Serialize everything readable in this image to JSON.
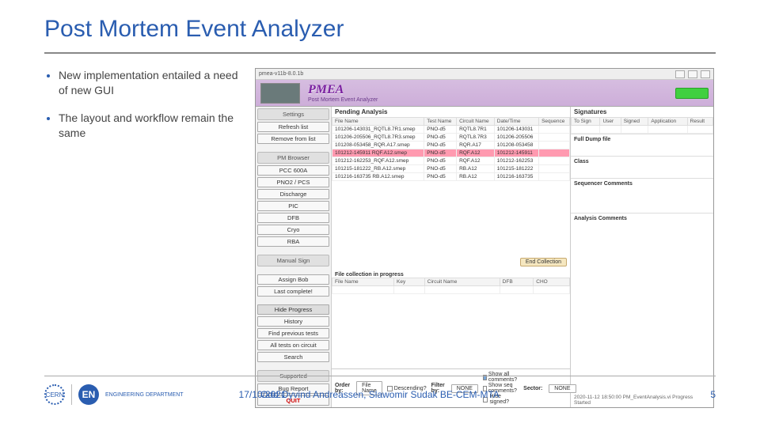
{
  "title": "Post Mortem Event Analyzer",
  "bullets": [
    "New implementation entailed a need of new GUI",
    "The layout and workflow remain the same"
  ],
  "app": {
    "windowTitle": "pmea-v11b-8.0.1b",
    "banner": {
      "logo": "PMEA",
      "sub": "Post Mortem Event Analyzer"
    },
    "side": {
      "settings": "Settings",
      "refresh": "Refresh list",
      "remove": "Remove from list",
      "pmBrowser": "PM Browser",
      "items": [
        "PCC 600A",
        "PNO2 / PCS",
        "Discharge",
        "PIC",
        "DFB",
        "Cryo",
        "RBA"
      ],
      "manualSign": "Manual Sign",
      "assign": "Assign Bob",
      "lastComplete": "Last complete!",
      "hideProgress": "Hide Progress",
      "history": "History",
      "findPrev": "Find previous tests",
      "allTests": "All tests on circuit",
      "search": "Search",
      "supported": "Supported",
      "bug": "Bug Report",
      "quit": "QUIT"
    },
    "pending": {
      "title": "Pending Analysis",
      "cols": [
        "File Name",
        "Test Name",
        "Circuit Name",
        "Date/Time",
        "Sequence"
      ],
      "rows": [
        [
          "101206-143031_RQTL8.7R1.smep",
          "PNO-d5",
          "RQTL8.7R1",
          "101206-143031",
          ""
        ],
        [
          "101206-205506_RQTL8.7R3.smep",
          "PNO-d5",
          "RQTL8.7R3",
          "101206-205506",
          ""
        ],
        [
          "101208-053458_RQR.A17.smep",
          "PNO-d5",
          "RQR.A17",
          "101208-053458",
          ""
        ],
        [
          "101212-145911 RQF.A12.smep",
          "PNO-d5",
          "RQF.A12",
          "101212-145911",
          ""
        ],
        [
          "101212-162253_RQF.A12.smep",
          "PNO-d5",
          "RQF.A12",
          "101212-162253",
          ""
        ],
        [
          "101215-181222_RB.A12.smep",
          "PNO-d5",
          "RB.A12",
          "101215-181222",
          ""
        ],
        [
          "101216-163735 RB.A12.smep",
          "PNO-d5",
          "RB.A12",
          "101216-163735",
          ""
        ]
      ],
      "highlightRow": 3,
      "sub": "File collection in progress",
      "cols2": [
        "File Name",
        "Key",
        "Circuit Name",
        "DFB",
        "CHO"
      ],
      "endCollection": "End Collection",
      "order": {
        "orderBy": "Order by:",
        "orderVal": "File Name",
        "desc": "Descending?",
        "filterBy": "Filter by:",
        "filterVal": "NONE",
        "checks": [
          "Show all comments?",
          "Show seq comments?",
          "Hide signed?"
        ],
        "sectorLabel": "Sector:",
        "sectorVal": "NONE"
      }
    },
    "sig": {
      "title": "Signatures",
      "cols": [
        "To Sign",
        "User",
        "Signed",
        "Application",
        "Result"
      ],
      "fullDump": "Full Dump file",
      "class": "Class",
      "seqComments": "Sequencer Comments",
      "anaComments": "Analysis Comments",
      "foot": "2020-11-12 18:50:00 PM_EventAnalysis.vi Progress Started"
    }
  },
  "footer": {
    "date": "17/10/2021",
    "center": "Odd Oyvind Andreassen, Slawomir Sudak BE-CEM-MTA",
    "page": "5",
    "logo1": "CERN",
    "logo2": "EN",
    "logo2sub": "ENGINEERING DEPARTMENT"
  }
}
